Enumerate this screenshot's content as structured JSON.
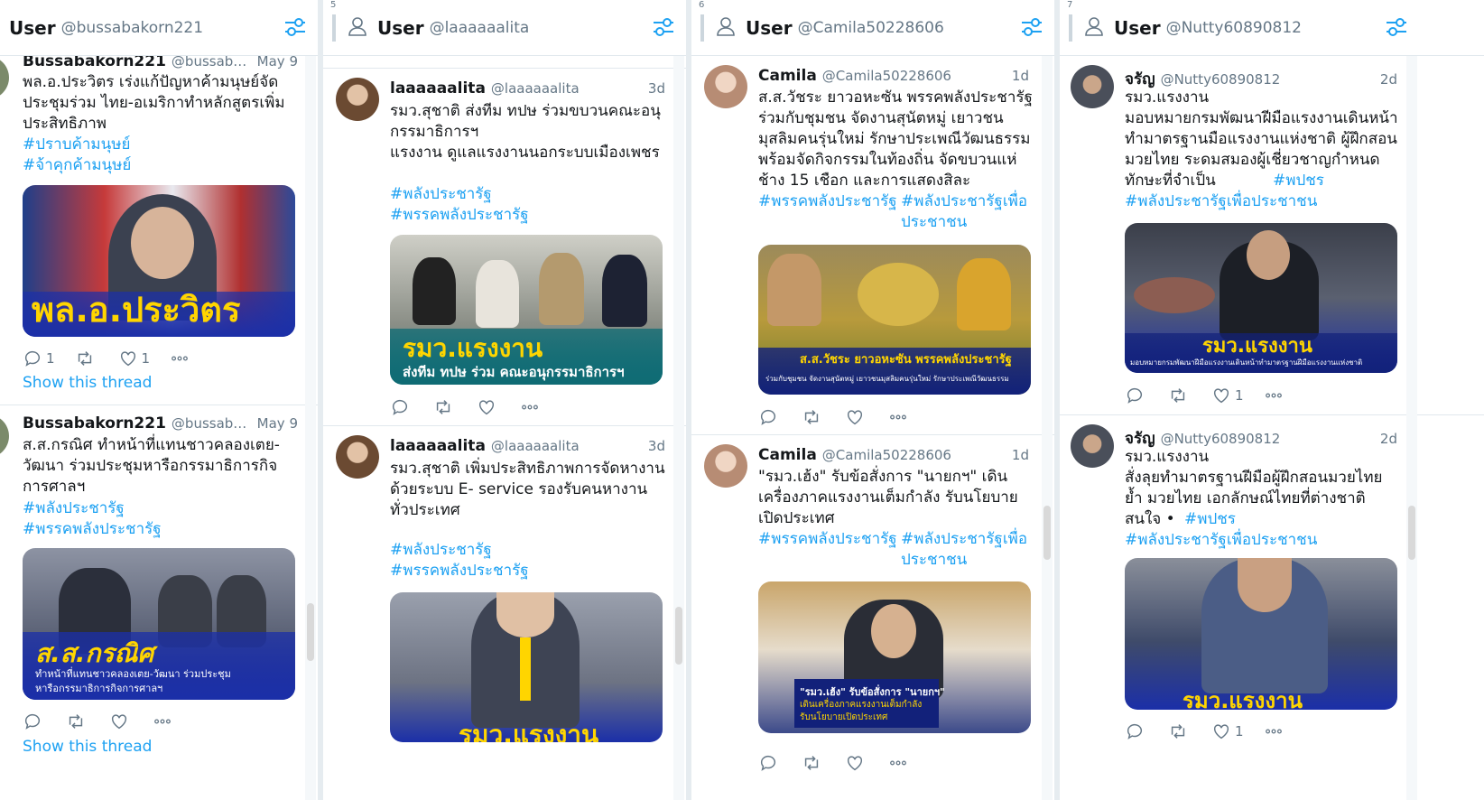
{
  "columns": [
    {
      "number": "",
      "title": "User",
      "handle": "@bussabakorn221",
      "tweets": [
        {
          "name": "Bussabakorn221",
          "handle": "@bussabakor...",
          "time": "May 9",
          "text": "พล.อ.ประวิตร เร่งแก้ปัญหาค้ามนุษย์จัดประชุมร่วม ไทย-อเมริกาทำหลักสูตรเพิ่มประสิทธิภาพ",
          "hashtags": [
            "#ปราบค้ามนุษย์",
            "#จ้าคุกค้ามนุษย์"
          ],
          "media_caption": "พล.อ.ประวิตร",
          "media_sub": "",
          "reply_count": "1",
          "retweet_count": "",
          "like_count": "1",
          "show_thread": "Show this thread"
        },
        {
          "name": "Bussabakorn221",
          "handle": "@bussabakor...",
          "time": "May 9",
          "text": "ส.ส.กรณิศ ทำหน้าที่แทนชาวคลองเตย-วัฒนา ร่วมประชุมหารือกรรมาธิการกิจการศาลฯ",
          "hashtags": [
            "#พลังประชารัฐ",
            "#พรรคพลังประชารัฐ"
          ],
          "media_caption": "ส.ส.กรณิศ",
          "media_sub": "ทำหน้าที่แทนชาวคลองเตย-วัฒนา ร่วมประชุมหารือกรรมาธิการกิจการศาลฯ",
          "reply_count": "",
          "retweet_count": "",
          "like_count": "",
          "show_thread": "Show this thread"
        }
      ]
    },
    {
      "number": "5",
      "title": "User",
      "handle": "@laaaaaalita",
      "tweets": [
        {
          "name": "laaaaaalita",
          "handle": "@laaaaaalita",
          "time": "3d",
          "text": "รมว.สุชาติ ส่งทีม ทปษ ร่วมขบวนคณะอนุกรรมาธิการฯ\nแรงงาน ดูแลแรงงานนอกระบบเมืองเพชร",
          "hashtags": [
            "#พลังประชารัฐ",
            "#พรรคพลังประชารัฐ"
          ],
          "media_caption": "รมว.แรงงาน",
          "media_sub": "ส่งทีม ทปษ ร่วม คณะอนุกรรมาธิการฯ",
          "reply_count": "",
          "retweet_count": "",
          "like_count": ""
        },
        {
          "name": "laaaaaalita",
          "handle": "@laaaaaalita",
          "time": "3d",
          "text": "รมว.สุชาติ เพิ่มประสิทธิภาพการจัดหางานด้วยระบบ E- service รองรับคนหางานทั่วประเทศ",
          "hashtags": [
            "#พลังประชารัฐ",
            "#พรรคพลังประชารัฐ"
          ],
          "media_caption": "รมว.แรงงาน",
          "media_sub": "",
          "reply_count": "",
          "retweet_count": "",
          "like_count": ""
        }
      ]
    },
    {
      "number": "6",
      "title": "User",
      "handle": "@Camila50228606",
      "tweets": [
        {
          "name": "Camila",
          "handle": "@Camila50228606",
          "time": "1d",
          "text": "ส.ส.วัชระ ยาวอหะซัน พรรคพลังประชารัฐร่วมกับชุมชน จัดงานสุนัตหมู่ เยาวชนมุสลิมคนรุ่นใหม่ รักษาประเพณีวัฒนธรรมพร้อมจัดกิจกรรมในท้องถิ่น จัดขบวนแห่ช้าง 15 เชือก และการแสดงสิละ",
          "hashtags": [
            "#พรรคพลังประชารัฐ",
            "#พลังประชารัฐเพื่อประชาชน"
          ],
          "media_caption": "ส.ส.วัชระ ยาวอหะซัน พรรคพลังประชารัฐ",
          "media_sub": "ร่วมกับชุมชน จัดงานสุนัตหมู่ เยาวชนมุสลิมคนรุ่นใหม่ รักษาประเพณีวัฒนธรรม",
          "reply_count": "",
          "retweet_count": "",
          "like_count": ""
        },
        {
          "name": "Camila",
          "handle": "@Camila50228606",
          "time": "1d",
          "text": "\"รมว.เฮ้ง\" รับข้อสั่งการ \"นายกฯ\" เดินเครื่องภาคแรงงานเต็มกำลัง รับนโยบายเปิดประเทศ",
          "hashtags": [
            "#พรรคพลังประชารัฐ",
            "#พลังประชารัฐเพื่อประชาชน"
          ],
          "media_caption": "\"รมว.เฮ้ง\" รับข้อสั่งการ \"นายกฯ\"",
          "media_sub": "เดินเครื่องภาคแรงงานเต็มกำลัง รับนโยบายเปิดประเทศ",
          "reply_count": "",
          "retweet_count": "",
          "like_count": ""
        }
      ]
    },
    {
      "number": "7",
      "title": "User",
      "handle": "@Nutty60890812",
      "tweets": [
        {
          "name": "จรัญ",
          "handle": "@Nutty60890812",
          "time": "2d",
          "text": "รมว.แรงงาน\nมอบหมายกรมพัฒนาฝีมือแรงงานเดินหน้าทำมาตรฐานมือแรงงานแห่งชาติ ผู้ฝึกสอนมวยไทย ระดมสมองผู้เชี่ยวชาญกำหนดทักษะที่จำเป็น",
          "hashtags": [
            "#พปชร",
            "#พลังประชารัฐเพื่อประชาชน"
          ],
          "media_caption": "รมว.แรงงาน",
          "media_sub": "มอบหมายกรมพัฒนาฝีมือแรงงานเดินหน้าทำมาตรฐานฝีมือแรงงานแห่งชาติ",
          "reply_count": "",
          "retweet_count": "",
          "like_count": "1"
        },
        {
          "name": "จรัญ",
          "handle": "@Nutty60890812",
          "time": "2d",
          "text": "รมว.แรงงาน\nสั่งลุยทำมาตรฐานฝีมือผู้ฝึกสอนมวยไทย ย้ำ มวยไทย เอกลักษณ์ไทยที่ต่างชาติสนใจ •",
          "hashtags": [
            "#พปชร",
            "#พลังประชารัฐเพื่อประชาชน"
          ],
          "media_caption": "รมว.แรงงาน",
          "media_sub": "",
          "reply_count": "",
          "retweet_count": "",
          "like_count": "1"
        }
      ]
    }
  ],
  "colors": {
    "accent": "#1da1f2",
    "text": "#14171a",
    "muted": "#657786",
    "border": "#e1e8ed",
    "banner_yellow": "#ffd500",
    "banner_navy": "#12217a"
  },
  "icons": [
    "user-icon",
    "filter-icon",
    "reply-icon",
    "retweet-icon",
    "like-icon",
    "more-icon"
  ]
}
